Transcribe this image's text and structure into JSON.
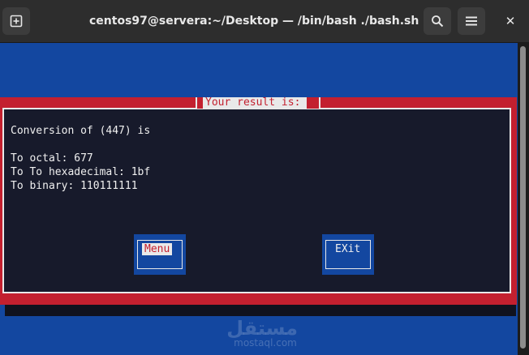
{
  "window": {
    "title": "centos97@servera:~/Desktop — /bin/bash ./bash.sh",
    "close_glyph": "✕"
  },
  "icons": {
    "new_tab": "new-tab-icon",
    "search": "search-icon",
    "menu": "hamburger-menu-icon",
    "close": "close-icon"
  },
  "colors": {
    "terminal_bg": "#1347a0",
    "dialog_border": "#c3202f",
    "dialog_bg": "#171a2b",
    "titlebar": "#2d2d2d"
  },
  "dialog": {
    "title": "Your result is:",
    "lines": [
      "Conversion of (447) is",
      "To octal: 677",
      "To To hexadecimal: 1bf",
      "To binary: 110111111"
    ],
    "buttons": {
      "menu": "Menu",
      "exit": "EXit"
    }
  },
  "watermark": {
    "arabic": "مستقل",
    "latin": "mostaql.com"
  }
}
